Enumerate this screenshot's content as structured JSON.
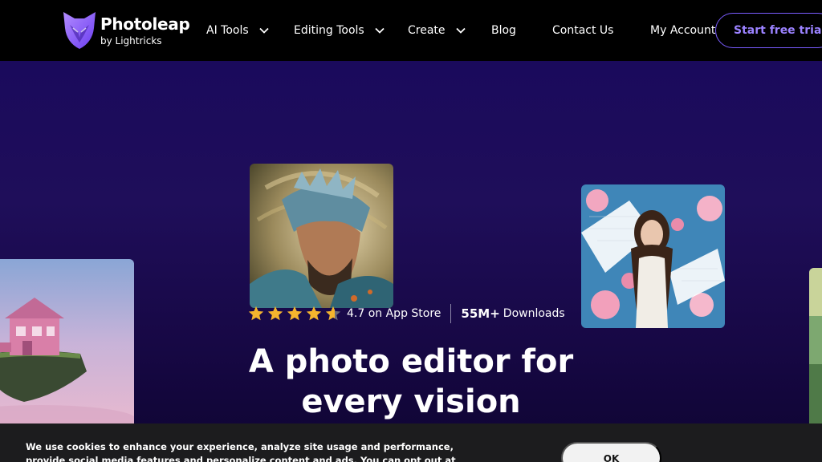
{
  "header": {
    "logo_title": "Photoleap",
    "logo_subtitle": "by Lightricks",
    "nav": [
      {
        "label": "AI Tools",
        "has_dropdown": true
      },
      {
        "label": "Editing Tools",
        "has_dropdown": true
      },
      {
        "label": "Create",
        "has_dropdown": true
      },
      {
        "label": "Blog",
        "has_dropdown": false
      },
      {
        "label": "Contact Us",
        "has_dropdown": false
      },
      {
        "label": "My Account",
        "has_dropdown": false
      }
    ],
    "cta_label": "Start free trial"
  },
  "hero": {
    "rating_text": "4.7 on App Store",
    "rating_value": 4.7,
    "downloads_count": "55M+",
    "downloads_label": "Downloads",
    "headline": "A photo editor for every vision"
  },
  "cookie_banner": {
    "text": "We use cookies to enhance your experience, analyze site usage and performance, provide social media features and personalize content and ads. You can opt out at any time by",
    "ok_label": "OK"
  },
  "colors": {
    "accent": "#7a5cff",
    "star": "#f5b52e",
    "hero_bg": "#1a0a5c"
  },
  "icons": [
    "fox-logo-icon",
    "chevron-down-icon",
    "star-icon",
    "half-star-icon"
  ]
}
